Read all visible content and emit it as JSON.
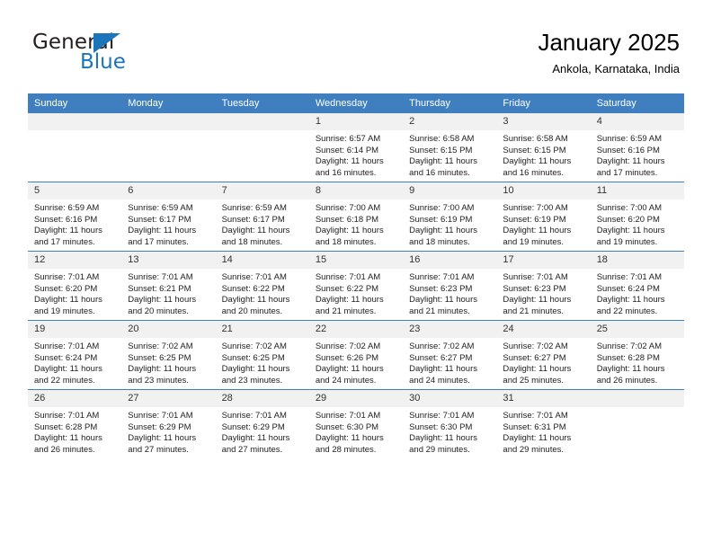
{
  "brand": {
    "word_one": "General",
    "word_two": "Blue",
    "triangle_color": "#1b75bb"
  },
  "header": {
    "title": "January 2025",
    "subtitle": "Ankola, Karnataka, India"
  },
  "colors": {
    "header_band": "#3f7fbf",
    "daynum_band": "#f1f1f1",
    "row_divider": "#3f7fbf",
    "brand_blue": "#1b75bb"
  },
  "weekday_headers": [
    "Sunday",
    "Monday",
    "Tuesday",
    "Wednesday",
    "Thursday",
    "Friday",
    "Saturday"
  ],
  "labels": {
    "sunrise_prefix": "Sunrise:",
    "sunset_prefix": "Sunset:",
    "daylight_prefix": "Daylight:"
  },
  "weeks": [
    [
      {
        "day": "",
        "empty": true,
        "sunrise": "",
        "sunset": "",
        "daylight_1": "",
        "daylight_2": ""
      },
      {
        "day": "",
        "empty": true,
        "sunrise": "",
        "sunset": "",
        "daylight_1": "",
        "daylight_2": ""
      },
      {
        "day": "",
        "empty": true,
        "sunrise": "",
        "sunset": "",
        "daylight_1": "",
        "daylight_2": ""
      },
      {
        "day": "1",
        "empty": false,
        "sunrise": "Sunrise: 6:57 AM",
        "sunset": "Sunset: 6:14 PM",
        "daylight_1": "Daylight: 11 hours",
        "daylight_2": "and 16 minutes."
      },
      {
        "day": "2",
        "empty": false,
        "sunrise": "Sunrise: 6:58 AM",
        "sunset": "Sunset: 6:15 PM",
        "daylight_1": "Daylight: 11 hours",
        "daylight_2": "and 16 minutes."
      },
      {
        "day": "3",
        "empty": false,
        "sunrise": "Sunrise: 6:58 AM",
        "sunset": "Sunset: 6:15 PM",
        "daylight_1": "Daylight: 11 hours",
        "daylight_2": "and 16 minutes."
      },
      {
        "day": "4",
        "empty": false,
        "sunrise": "Sunrise: 6:59 AM",
        "sunset": "Sunset: 6:16 PM",
        "daylight_1": "Daylight: 11 hours",
        "daylight_2": "and 17 minutes."
      }
    ],
    [
      {
        "day": "5",
        "empty": false,
        "sunrise": "Sunrise: 6:59 AM",
        "sunset": "Sunset: 6:16 PM",
        "daylight_1": "Daylight: 11 hours",
        "daylight_2": "and 17 minutes."
      },
      {
        "day": "6",
        "empty": false,
        "sunrise": "Sunrise: 6:59 AM",
        "sunset": "Sunset: 6:17 PM",
        "daylight_1": "Daylight: 11 hours",
        "daylight_2": "and 17 minutes."
      },
      {
        "day": "7",
        "empty": false,
        "sunrise": "Sunrise: 6:59 AM",
        "sunset": "Sunset: 6:17 PM",
        "daylight_1": "Daylight: 11 hours",
        "daylight_2": "and 18 minutes."
      },
      {
        "day": "8",
        "empty": false,
        "sunrise": "Sunrise: 7:00 AM",
        "sunset": "Sunset: 6:18 PM",
        "daylight_1": "Daylight: 11 hours",
        "daylight_2": "and 18 minutes."
      },
      {
        "day": "9",
        "empty": false,
        "sunrise": "Sunrise: 7:00 AM",
        "sunset": "Sunset: 6:19 PM",
        "daylight_1": "Daylight: 11 hours",
        "daylight_2": "and 18 minutes."
      },
      {
        "day": "10",
        "empty": false,
        "sunrise": "Sunrise: 7:00 AM",
        "sunset": "Sunset: 6:19 PM",
        "daylight_1": "Daylight: 11 hours",
        "daylight_2": "and 19 minutes."
      },
      {
        "day": "11",
        "empty": false,
        "sunrise": "Sunrise: 7:00 AM",
        "sunset": "Sunset: 6:20 PM",
        "daylight_1": "Daylight: 11 hours",
        "daylight_2": "and 19 minutes."
      }
    ],
    [
      {
        "day": "12",
        "empty": false,
        "sunrise": "Sunrise: 7:01 AM",
        "sunset": "Sunset: 6:20 PM",
        "daylight_1": "Daylight: 11 hours",
        "daylight_2": "and 19 minutes."
      },
      {
        "day": "13",
        "empty": false,
        "sunrise": "Sunrise: 7:01 AM",
        "sunset": "Sunset: 6:21 PM",
        "daylight_1": "Daylight: 11 hours",
        "daylight_2": "and 20 minutes."
      },
      {
        "day": "14",
        "empty": false,
        "sunrise": "Sunrise: 7:01 AM",
        "sunset": "Sunset: 6:22 PM",
        "daylight_1": "Daylight: 11 hours",
        "daylight_2": "and 20 minutes."
      },
      {
        "day": "15",
        "empty": false,
        "sunrise": "Sunrise: 7:01 AM",
        "sunset": "Sunset: 6:22 PM",
        "daylight_1": "Daylight: 11 hours",
        "daylight_2": "and 21 minutes."
      },
      {
        "day": "16",
        "empty": false,
        "sunrise": "Sunrise: 7:01 AM",
        "sunset": "Sunset: 6:23 PM",
        "daylight_1": "Daylight: 11 hours",
        "daylight_2": "and 21 minutes."
      },
      {
        "day": "17",
        "empty": false,
        "sunrise": "Sunrise: 7:01 AM",
        "sunset": "Sunset: 6:23 PM",
        "daylight_1": "Daylight: 11 hours",
        "daylight_2": "and 21 minutes."
      },
      {
        "day": "18",
        "empty": false,
        "sunrise": "Sunrise: 7:01 AM",
        "sunset": "Sunset: 6:24 PM",
        "daylight_1": "Daylight: 11 hours",
        "daylight_2": "and 22 minutes."
      }
    ],
    [
      {
        "day": "19",
        "empty": false,
        "sunrise": "Sunrise: 7:01 AM",
        "sunset": "Sunset: 6:24 PM",
        "daylight_1": "Daylight: 11 hours",
        "daylight_2": "and 22 minutes."
      },
      {
        "day": "20",
        "empty": false,
        "sunrise": "Sunrise: 7:02 AM",
        "sunset": "Sunset: 6:25 PM",
        "daylight_1": "Daylight: 11 hours",
        "daylight_2": "and 23 minutes."
      },
      {
        "day": "21",
        "empty": false,
        "sunrise": "Sunrise: 7:02 AM",
        "sunset": "Sunset: 6:25 PM",
        "daylight_1": "Daylight: 11 hours",
        "daylight_2": "and 23 minutes."
      },
      {
        "day": "22",
        "empty": false,
        "sunrise": "Sunrise: 7:02 AM",
        "sunset": "Sunset: 6:26 PM",
        "daylight_1": "Daylight: 11 hours",
        "daylight_2": "and 24 minutes."
      },
      {
        "day": "23",
        "empty": false,
        "sunrise": "Sunrise: 7:02 AM",
        "sunset": "Sunset: 6:27 PM",
        "daylight_1": "Daylight: 11 hours",
        "daylight_2": "and 24 minutes."
      },
      {
        "day": "24",
        "empty": false,
        "sunrise": "Sunrise: 7:02 AM",
        "sunset": "Sunset: 6:27 PM",
        "daylight_1": "Daylight: 11 hours",
        "daylight_2": "and 25 minutes."
      },
      {
        "day": "25",
        "empty": false,
        "sunrise": "Sunrise: 7:02 AM",
        "sunset": "Sunset: 6:28 PM",
        "daylight_1": "Daylight: 11 hours",
        "daylight_2": "and 26 minutes."
      }
    ],
    [
      {
        "day": "26",
        "empty": false,
        "sunrise": "Sunrise: 7:01 AM",
        "sunset": "Sunset: 6:28 PM",
        "daylight_1": "Daylight: 11 hours",
        "daylight_2": "and 26 minutes."
      },
      {
        "day": "27",
        "empty": false,
        "sunrise": "Sunrise: 7:01 AM",
        "sunset": "Sunset: 6:29 PM",
        "daylight_1": "Daylight: 11 hours",
        "daylight_2": "and 27 minutes."
      },
      {
        "day": "28",
        "empty": false,
        "sunrise": "Sunrise: 7:01 AM",
        "sunset": "Sunset: 6:29 PM",
        "daylight_1": "Daylight: 11 hours",
        "daylight_2": "and 27 minutes."
      },
      {
        "day": "29",
        "empty": false,
        "sunrise": "Sunrise: 7:01 AM",
        "sunset": "Sunset: 6:30 PM",
        "daylight_1": "Daylight: 11 hours",
        "daylight_2": "and 28 minutes."
      },
      {
        "day": "30",
        "empty": false,
        "sunrise": "Sunrise: 7:01 AM",
        "sunset": "Sunset: 6:30 PM",
        "daylight_1": "Daylight: 11 hours",
        "daylight_2": "and 29 minutes."
      },
      {
        "day": "31",
        "empty": false,
        "sunrise": "Sunrise: 7:01 AM",
        "sunset": "Sunset: 6:31 PM",
        "daylight_1": "Daylight: 11 hours",
        "daylight_2": "and 29 minutes."
      },
      {
        "day": "",
        "empty": true,
        "sunrise": "",
        "sunset": "",
        "daylight_1": "",
        "daylight_2": ""
      }
    ]
  ]
}
